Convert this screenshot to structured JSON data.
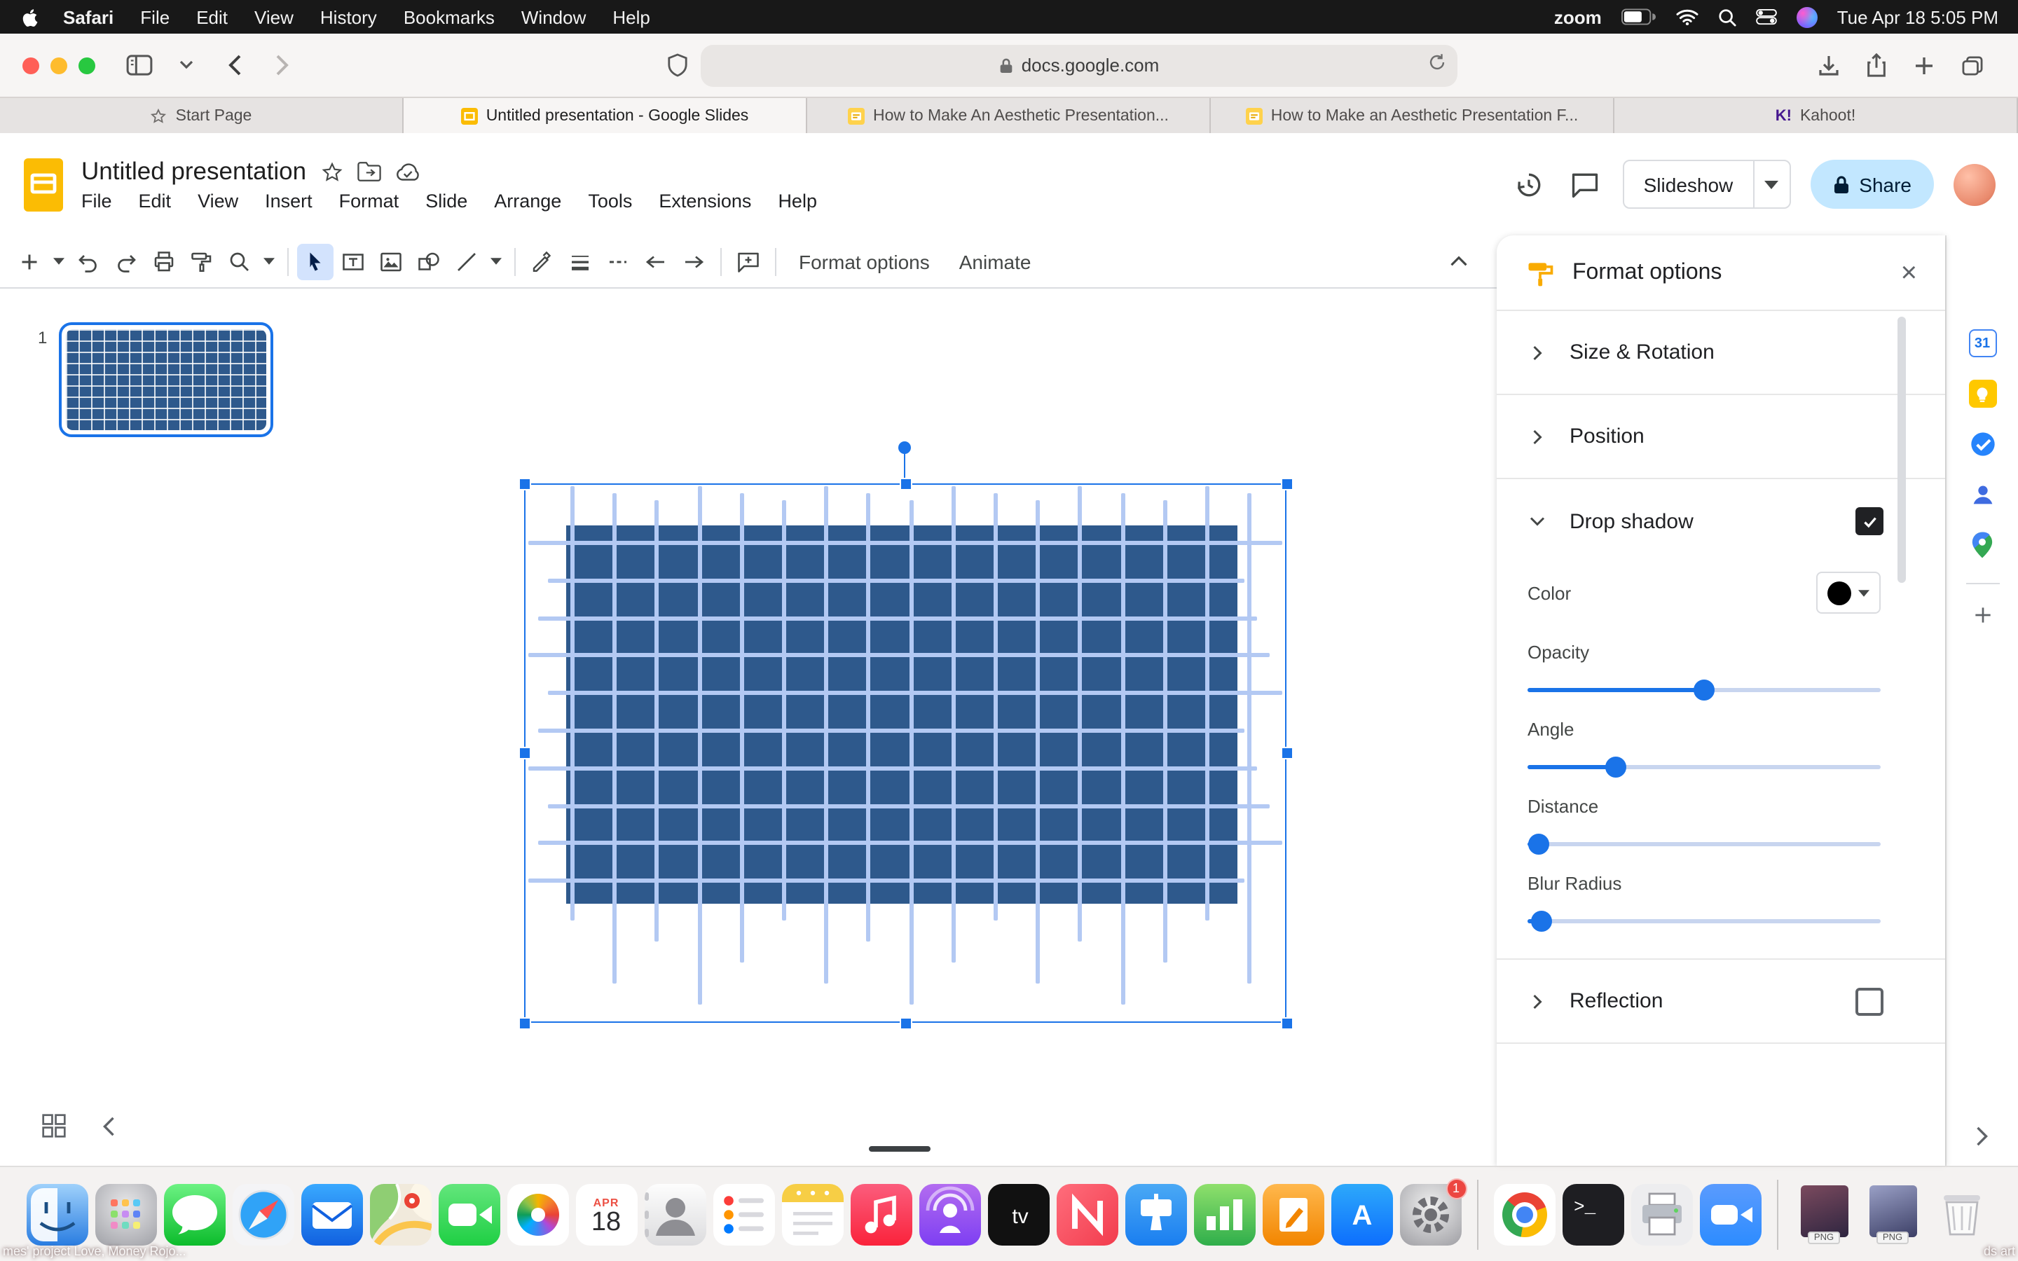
{
  "menubar": {
    "app": "Safari",
    "items": [
      "File",
      "Edit",
      "View",
      "History",
      "Bookmarks",
      "Window",
      "Help"
    ],
    "zoom_label": "zoom",
    "clock": "Tue Apr 18 5:05 PM"
  },
  "browser": {
    "url": "docs.google.com",
    "tabs": [
      {
        "label": "Start Page",
        "icon": "star",
        "active": false
      },
      {
        "label": "Untitled presentation - Google Slides",
        "icon": "slides",
        "active": true
      },
      {
        "label": "How to Make An Aesthetic Presentation...",
        "icon": "slides-file",
        "active": false
      },
      {
        "label": "How to Make an Aesthetic Presentation F...",
        "icon": "slides-file",
        "active": false
      },
      {
        "label": "Kahoot!",
        "icon": "kahoot",
        "active": false
      }
    ]
  },
  "header": {
    "doc_title": "Untitled presentation",
    "menus": [
      "File",
      "Edit",
      "View",
      "Insert",
      "Format",
      "Slide",
      "Arrange",
      "Tools",
      "Extensions",
      "Help"
    ],
    "slideshow": "Slideshow",
    "share": "Share"
  },
  "toolbar": {
    "format_options": "Format options",
    "animate": "Animate"
  },
  "filmstrip": {
    "slide_number": "1"
  },
  "panel": {
    "title": "Format options",
    "size_rotation": "Size & Rotation",
    "position": "Position",
    "drop_shadow": "Drop shadow",
    "reflection": "Reflection",
    "color_label": "Color",
    "drop_shadow_checked": true,
    "reflection_checked": false,
    "sliders": [
      {
        "label": "Opacity",
        "value": 50
      },
      {
        "label": "Angle",
        "value": 25
      },
      {
        "label": "Distance",
        "value": 3
      },
      {
        "label": "Blur Radius",
        "value": 4
      }
    ]
  },
  "canvas": {
    "grid": {
      "cols": 17,
      "rows": 10
    }
  },
  "rail": [
    "calendar",
    "keep",
    "tasks",
    "contacts",
    "maps"
  ],
  "dock": [
    {
      "name": "finder"
    },
    {
      "name": "launchpad"
    },
    {
      "name": "messages"
    },
    {
      "name": "safari"
    },
    {
      "name": "mail"
    },
    {
      "name": "maps"
    },
    {
      "name": "facetime"
    },
    {
      "name": "photos"
    },
    {
      "name": "calendar",
      "top": "APR",
      "day": "18"
    },
    {
      "name": "contacts"
    },
    {
      "name": "reminders"
    },
    {
      "name": "notes"
    },
    {
      "name": "music"
    },
    {
      "name": "podcasts"
    },
    {
      "name": "tv"
    },
    {
      "name": "news"
    },
    {
      "name": "keynote"
    },
    {
      "name": "numbers"
    },
    {
      "name": "pages"
    },
    {
      "name": "appstore"
    },
    {
      "name": "settings",
      "badge": "1"
    },
    {
      "name": "sep"
    },
    {
      "name": "chrome"
    },
    {
      "name": "terminal"
    },
    {
      "name": "printer"
    },
    {
      "name": "zoom"
    },
    {
      "name": "sep"
    },
    {
      "name": "file",
      "label": "PNG"
    },
    {
      "name": "file",
      "label": "PNG"
    },
    {
      "name": "trash"
    }
  ],
  "desktop": {
    "left_fragment": "mes' project Love, Money Rojo...",
    "right_fragment": "ds art"
  }
}
